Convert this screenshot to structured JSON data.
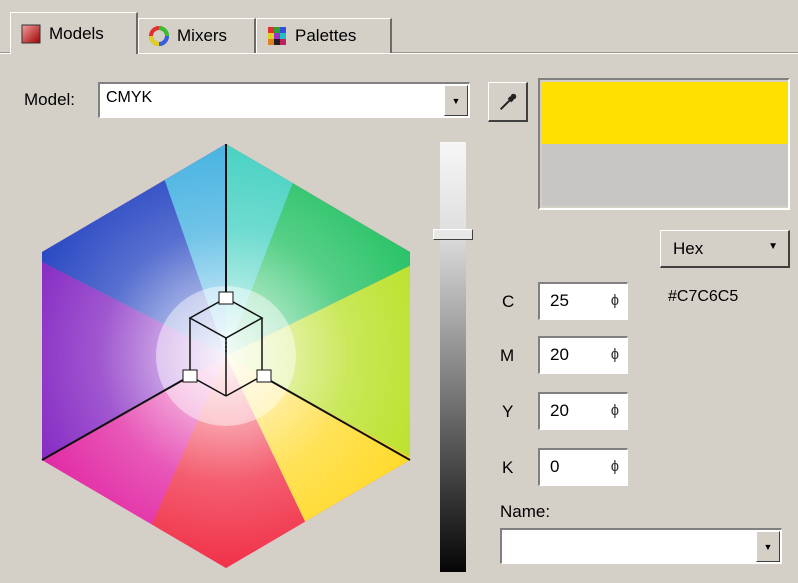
{
  "tabs": [
    {
      "label": "Models",
      "icon": "models-icon",
      "active": true
    },
    {
      "label": "Mixers",
      "icon": "mixers-icon",
      "active": false
    },
    {
      "label": "Palettes",
      "icon": "palettes-icon",
      "active": false
    }
  ],
  "model": {
    "label": "Model:",
    "value": "CMYK"
  },
  "swatch": {
    "new_color": "#FFE000",
    "old_color": "#C7C6C5"
  },
  "format": {
    "value": "Hex",
    "hex": "#C7C6C5"
  },
  "channels": [
    {
      "label": "C",
      "value": "25"
    },
    {
      "label": "M",
      "value": "20"
    },
    {
      "label": "Y",
      "value": "20"
    },
    {
      "label": "K",
      "value": "0"
    }
  ],
  "name": {
    "label": "Name:",
    "value": ""
  },
  "icons": {
    "picker": "eyedropper-icon",
    "dropdown": "chevron-down-icon",
    "spin": "spin-arrows-icon"
  }
}
